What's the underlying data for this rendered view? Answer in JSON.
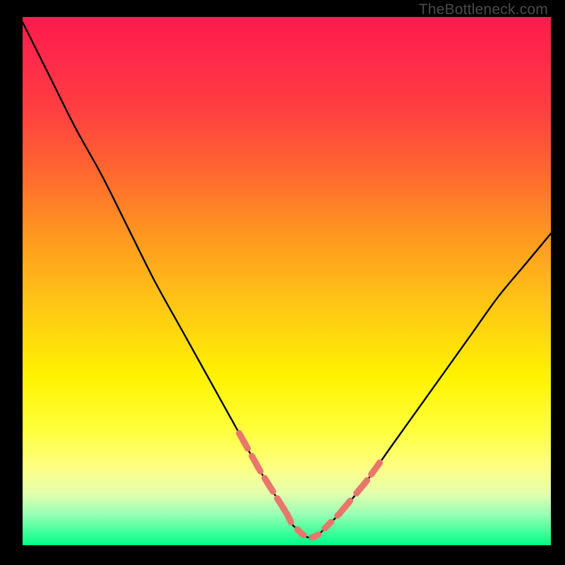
{
  "watermark": "TheBottleneck.com",
  "colors": {
    "background": "#000000",
    "curve": "#000000",
    "dash": "#e9766c",
    "watermark_text": "#4a4a4a"
  },
  "chart_data": {
    "type": "line",
    "title": "",
    "xlabel": "",
    "ylabel": "",
    "xlim": [
      0,
      100
    ],
    "ylim": [
      0,
      100
    ],
    "series": [
      {
        "name": "bottleneck-curve",
        "x": [
          0,
          5,
          10,
          15,
          20,
          25,
          30,
          35,
          40,
          45,
          50,
          51,
          52,
          53,
          54,
          55,
          56,
          57,
          58,
          60,
          65,
          70,
          75,
          80,
          85,
          90,
          95,
          100
        ],
        "values": [
          99,
          89,
          79,
          70,
          60,
          50,
          41,
          32,
          23,
          14,
          6,
          4,
          3,
          2,
          1.5,
          1.5,
          2,
          3,
          4,
          6,
          12,
          19,
          26,
          33,
          40,
          47,
          53,
          59
        ]
      }
    ],
    "annotations": {
      "dashed_segments_left": {
        "x_start": 41,
        "x_end": 50
      },
      "dashed_segments_right": {
        "x_start": 60,
        "x_end": 68
      },
      "valley_dashes": {
        "x_start": 50,
        "x_end": 60
      }
    }
  }
}
